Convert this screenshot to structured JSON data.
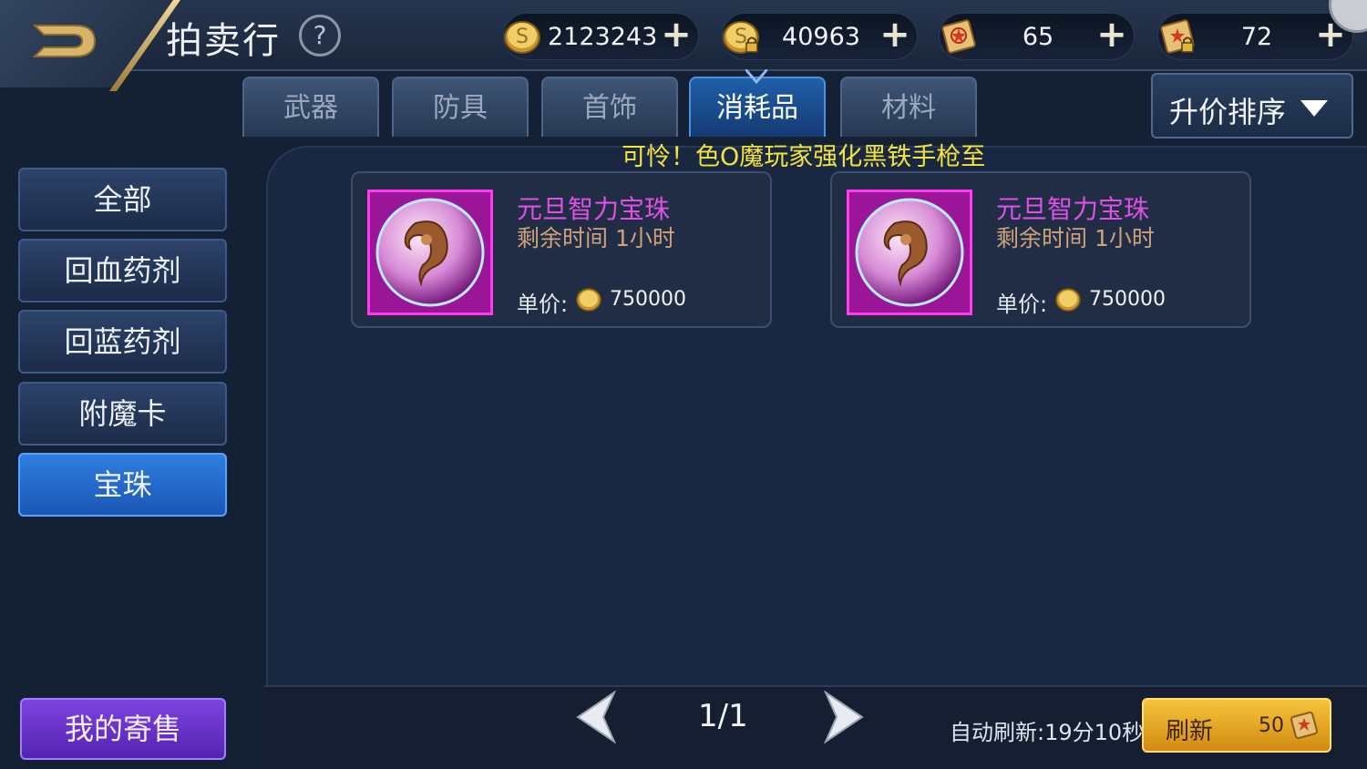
{
  "header": {
    "title": "拍卖行",
    "help_label": "?",
    "currencies": [
      {
        "name": "gold-coin",
        "value": "2123243",
        "plus": "+"
      },
      {
        "name": "locked-gold-coin",
        "value": "40963",
        "plus": "+"
      },
      {
        "name": "scroll",
        "value": "65",
        "plus": "+"
      },
      {
        "name": "locked-scroll",
        "value": "72",
        "plus": "+"
      }
    ]
  },
  "tabs": [
    {
      "label": "武器"
    },
    {
      "label": "防具"
    },
    {
      "label": "首饰"
    },
    {
      "label": "消耗品",
      "active": true
    },
    {
      "label": "材料"
    }
  ],
  "sort": {
    "label": "升价排序"
  },
  "ticker": {
    "text": "可怜！色O魔玩家强化黑铁手枪至"
  },
  "categories": [
    {
      "label": "全部"
    },
    {
      "label": "回血药剂"
    },
    {
      "label": "回蓝药剂"
    },
    {
      "label": "附魔卡"
    },
    {
      "label": "宝珠",
      "active": true
    }
  ],
  "my_sale": {
    "label": "我的寄售"
  },
  "items": [
    {
      "name": "元旦智力宝珠",
      "time": "剩余时间  1小时",
      "price_label": "单价:",
      "price": "750000"
    },
    {
      "name": "元旦智力宝珠",
      "time": "剩余时间  1小时",
      "price_label": "单价:",
      "price": "750000"
    }
  ],
  "pagination": {
    "page": "1/1"
  },
  "auto_refresh": {
    "text": "自动刷新:19分10秒"
  },
  "refresh": {
    "label": "刷新",
    "cost": "50"
  },
  "colors": {
    "accent_blue": "#2f7ee0",
    "item_name_magenta": "#e04fe6",
    "ticker_yellow": "#f3e33d",
    "refresh_gold": "#f6c43b",
    "my_sale_purple": "#7e43e0"
  }
}
